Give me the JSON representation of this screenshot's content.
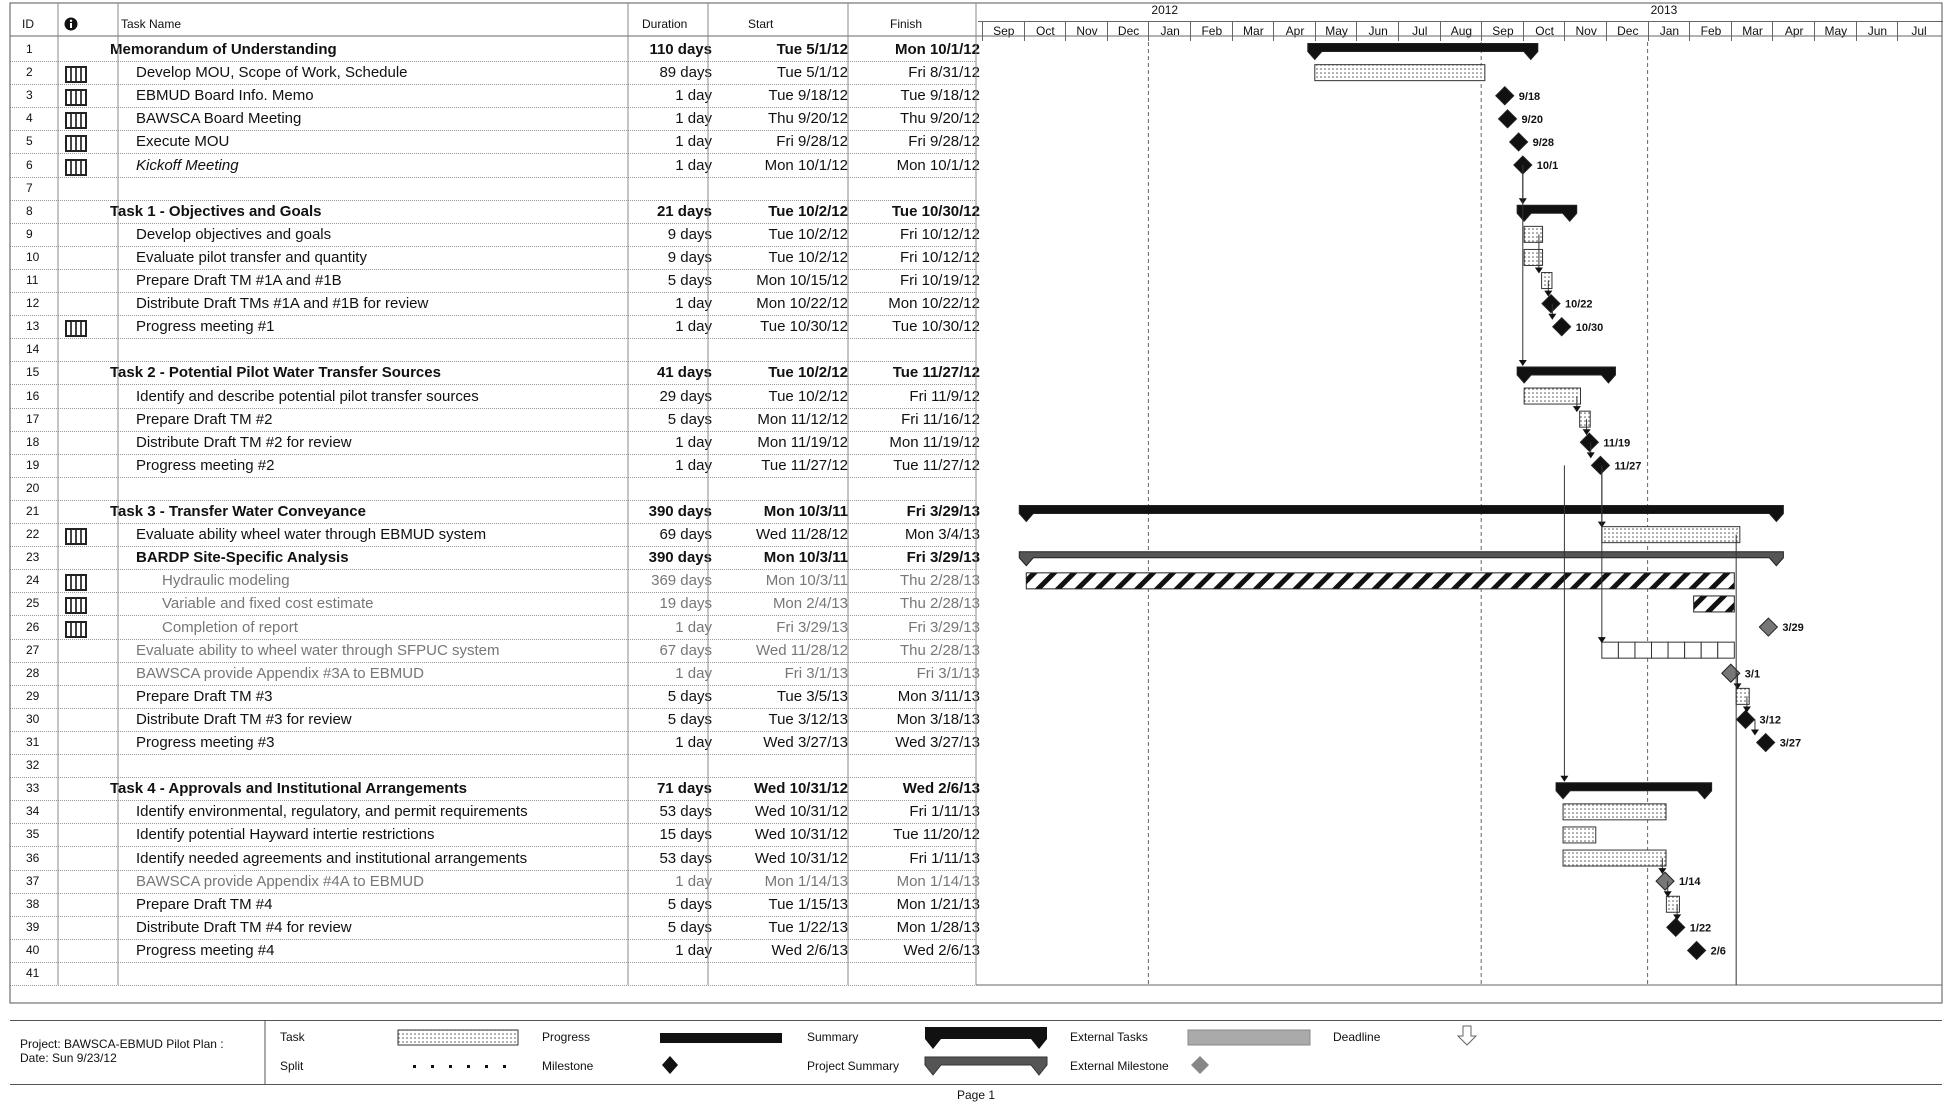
{
  "columns": {
    "id": "ID",
    "info": "info-icon",
    "name": "Task Name",
    "duration": "Duration",
    "start": "Start",
    "finish": "Finish"
  },
  "timeline": {
    "years": [
      {
        "label": "2012",
        "month_index": 4
      },
      {
        "label": "2013",
        "month_index": 16
      }
    ],
    "months": [
      "Sep",
      "Oct",
      "Nov",
      "Dec",
      "Jan",
      "Feb",
      "Mar",
      "Apr",
      "May",
      "Jun",
      "Jul",
      "Aug",
      "Sep",
      "Oct",
      "Nov",
      "Dec",
      "Jan",
      "Feb",
      "Mar",
      "Apr",
      "May",
      "Jun",
      "Jul"
    ]
  },
  "tasks": [
    {
      "id": "1",
      "name": "Memorandum of Understanding",
      "dur": "110 days",
      "start": "Tue 5/1/12",
      "finish": "Mon 10/1/12",
      "style": "sum",
      "indent": 0,
      "bar": {
        "kind": "summary",
        "from": "2012-05-01",
        "to": "2012-10-01"
      }
    },
    {
      "id": "2",
      "note": true,
      "name": "Develop MOU, Scope of Work, Schedule",
      "dur": "89 days",
      "start": "Tue 5/1/12",
      "finish": "Fri 8/31/12",
      "indent": 1,
      "bar": {
        "kind": "task",
        "from": "2012-05-01",
        "to": "2012-08-31"
      }
    },
    {
      "id": "3",
      "note": true,
      "name": "EBMUD Board Info. Memo",
      "dur": "1 day",
      "start": "Tue 9/18/12",
      "finish": "Tue 9/18/12",
      "indent": 1,
      "bar": {
        "kind": "milestone",
        "at": "2012-09-18",
        "label": "9/18"
      }
    },
    {
      "id": "4",
      "note": true,
      "name": "BAWSCA Board Meeting",
      "dur": "1 day",
      "start": "Thu 9/20/12",
      "finish": "Thu 9/20/12",
      "indent": 1,
      "bar": {
        "kind": "milestone",
        "at": "2012-09-20",
        "label": "9/20"
      }
    },
    {
      "id": "5",
      "note": true,
      "name": "Execute MOU",
      "dur": "1 day",
      "start": "Fri 9/28/12",
      "finish": "Fri 9/28/12",
      "indent": 1,
      "bar": {
        "kind": "milestone",
        "at": "2012-09-28",
        "label": "9/28"
      }
    },
    {
      "id": "6",
      "note": true,
      "name": "Kickoff Meeting",
      "dur": "1 day",
      "start": "Mon 10/1/12",
      "finish": "Mon 10/1/12",
      "style": "ital",
      "indent": 1,
      "bar": {
        "kind": "milestone",
        "at": "2012-10-01",
        "label": "10/1"
      }
    },
    {
      "id": "7",
      "name": "",
      "dur": "",
      "start": "",
      "finish": "",
      "indent": 0
    },
    {
      "id": "8",
      "name": "Task 1 - Objectives and Goals",
      "dur": "21 days",
      "start": "Tue 10/2/12",
      "finish": "Tue 10/30/12",
      "style": "sum",
      "indent": 0,
      "bar": {
        "kind": "summary",
        "from": "2012-10-02",
        "to": "2012-10-30"
      }
    },
    {
      "id": "9",
      "name": "Develop objectives and goals",
      "dur": "9 days",
      "start": "Tue 10/2/12",
      "finish": "Fri 10/12/12",
      "indent": 1,
      "bar": {
        "kind": "task",
        "from": "2012-10-02",
        "to": "2012-10-12"
      }
    },
    {
      "id": "10",
      "name": "Evaluate pilot transfer and quantity",
      "dur": "9 days",
      "start": "Tue 10/2/12",
      "finish": "Fri 10/12/12",
      "indent": 1,
      "bar": {
        "kind": "task",
        "from": "2012-10-02",
        "to": "2012-10-12"
      }
    },
    {
      "id": "11",
      "name": "Prepare Draft TM #1A and #1B",
      "dur": "5 days",
      "start": "Mon 10/15/12",
      "finish": "Fri 10/19/12",
      "indent": 1,
      "bar": {
        "kind": "task",
        "from": "2012-10-15",
        "to": "2012-10-19"
      }
    },
    {
      "id": "12",
      "name": "Distribute Draft TMs #1A and #1B for review",
      "dur": "1 day",
      "start": "Mon 10/22/12",
      "finish": "Mon 10/22/12",
      "indent": 1,
      "bar": {
        "kind": "milestone",
        "at": "2012-10-22",
        "label": "10/22"
      }
    },
    {
      "id": "13",
      "note": true,
      "name": "Progress meeting #1",
      "dur": "1 day",
      "start": "Tue 10/30/12",
      "finish": "Tue 10/30/12",
      "indent": 1,
      "bar": {
        "kind": "milestone",
        "at": "2012-10-30",
        "label": "10/30"
      }
    },
    {
      "id": "14",
      "name": "",
      "dur": "",
      "start": "",
      "finish": "",
      "indent": 0
    },
    {
      "id": "15",
      "name": "Task 2 - Potential Pilot Water Transfer Sources",
      "dur": "41 days",
      "start": "Tue 10/2/12",
      "finish": "Tue 11/27/12",
      "style": "sum",
      "indent": 0,
      "bar": {
        "kind": "summary",
        "from": "2012-10-02",
        "to": "2012-11-27"
      }
    },
    {
      "id": "16",
      "name": "Identify and describe potential pilot transfer sources",
      "dur": "29 days",
      "start": "Tue 10/2/12",
      "finish": "Fri 11/9/12",
      "indent": 1,
      "bar": {
        "kind": "task",
        "from": "2012-10-02",
        "to": "2012-11-09"
      }
    },
    {
      "id": "17",
      "name": "Prepare Draft TM #2",
      "dur": "5 days",
      "start": "Mon 11/12/12",
      "finish": "Fri 11/16/12",
      "indent": 1,
      "bar": {
        "kind": "task",
        "from": "2012-11-12",
        "to": "2012-11-16"
      }
    },
    {
      "id": "18",
      "name": "Distribute Draft TM #2 for review",
      "dur": "1 day",
      "start": "Mon 11/19/12",
      "finish": "Mon 11/19/12",
      "indent": 1,
      "bar": {
        "kind": "milestone",
        "at": "2012-11-19",
        "label": "11/19"
      }
    },
    {
      "id": "19",
      "name": "Progress meeting #2",
      "dur": "1 day",
      "start": "Tue 11/27/12",
      "finish": "Tue 11/27/12",
      "indent": 1,
      "bar": {
        "kind": "milestone",
        "at": "2012-11-27",
        "label": "11/27"
      }
    },
    {
      "id": "20",
      "name": "",
      "dur": "",
      "start": "",
      "finish": "",
      "indent": 0
    },
    {
      "id": "21",
      "name": "Task 3 - Transfer Water Conveyance",
      "dur": "390 days",
      "start": "Mon 10/3/11",
      "finish": "Fri 3/29/13",
      "style": "sum",
      "indent": 0,
      "bar": {
        "kind": "summary",
        "from": "2011-10-03",
        "to": "2013-03-29"
      }
    },
    {
      "id": "22",
      "note": true,
      "name": "Evaluate ability wheel water through EBMUD system",
      "dur": "69 days",
      "start": "Wed 11/28/12",
      "finish": "Mon 3/4/13",
      "indent": 1,
      "bar": {
        "kind": "task",
        "from": "2012-11-28",
        "to": "2013-03-04"
      }
    },
    {
      "id": "23",
      "name": "BARDP Site-Specific Analysis",
      "dur": "390 days",
      "start": "Mon 10/3/11",
      "finish": "Fri 3/29/13",
      "style": "sum",
      "indent": 1,
      "bar": {
        "kind": "extsummary",
        "from": "2011-10-03",
        "to": "2013-03-29"
      }
    },
    {
      "id": "24",
      "note": true,
      "name": "Hydraulic modeling",
      "dur": "369 days",
      "start": "Mon 10/3/11",
      "finish": "Thu 2/28/13",
      "style": "grey",
      "indent": 2,
      "bar": {
        "kind": "ext",
        "from": "2011-10-03",
        "to": "2013-02-28"
      }
    },
    {
      "id": "25",
      "note": true,
      "name": "Variable and fixed cost estimate",
      "dur": "19 days",
      "start": "Mon 2/4/13",
      "finish": "Thu 2/28/13",
      "style": "grey",
      "indent": 2,
      "bar": {
        "kind": "ext",
        "from": "2013-02-04",
        "to": "2013-02-28"
      }
    },
    {
      "id": "26",
      "note": true,
      "name": "Completion of report",
      "dur": "1 day",
      "start": "Fri 3/29/13",
      "finish": "Fri 3/29/13",
      "style": "grey",
      "indent": 2,
      "bar": {
        "kind": "extmilestone",
        "at": "2013-03-29",
        "label": "3/29"
      }
    },
    {
      "id": "27",
      "name": "Evaluate ability to wheel water through SFPUC system",
      "dur": "67 days",
      "start": "Wed 11/28/12",
      "finish": "Thu 2/28/13",
      "style": "grey",
      "indent": 1,
      "bar": {
        "kind": "boxes",
        "from": "2012-11-28",
        "to": "2013-02-28"
      }
    },
    {
      "id": "28",
      "name": "BAWSCA provide Appendix #3A to EBMUD",
      "dur": "1 day",
      "start": "Fri 3/1/13",
      "finish": "Fri 3/1/13",
      "style": "grey",
      "indent": 1,
      "bar": {
        "kind": "extmilestone",
        "at": "2013-03-01",
        "label": "3/1"
      }
    },
    {
      "id": "29",
      "name": "Prepare Draft TM #3",
      "dur": "5 days",
      "start": "Tue 3/5/13",
      "finish": "Mon 3/11/13",
      "indent": 1,
      "bar": {
        "kind": "task",
        "from": "2013-03-05",
        "to": "2013-03-11"
      }
    },
    {
      "id": "30",
      "name": "Distribute Draft TM #3 for review",
      "dur": "5 days",
      "start": "Tue 3/12/13",
      "finish": "Mon 3/18/13",
      "indent": 1,
      "bar": {
        "kind": "milestone",
        "at": "2013-03-12",
        "label": "3/12"
      }
    },
    {
      "id": "31",
      "name": "Progress meeting #3",
      "dur": "1 day",
      "start": "Wed 3/27/13",
      "finish": "Wed 3/27/13",
      "indent": 1,
      "bar": {
        "kind": "milestone",
        "at": "2013-03-27",
        "label": "3/27"
      }
    },
    {
      "id": "32",
      "name": "",
      "dur": "",
      "start": "",
      "finish": "",
      "indent": 0
    },
    {
      "id": "33",
      "name": "Task 4 - Approvals and Institutional Arrangements",
      "dur": "71 days",
      "start": "Wed 10/31/12",
      "finish": "Wed 2/6/13",
      "style": "sum",
      "indent": 0,
      "bar": {
        "kind": "summary",
        "from": "2012-10-31",
        "to": "2013-02-06"
      }
    },
    {
      "id": "34",
      "name": "Identify environmental, regulatory, and permit requirements",
      "dur": "53 days",
      "start": "Wed 10/31/12",
      "finish": "Fri 1/11/13",
      "indent": 1,
      "bar": {
        "kind": "task",
        "from": "2012-10-31",
        "to": "2013-01-11"
      }
    },
    {
      "id": "35",
      "name": "Identify potential Hayward intertie restrictions",
      "dur": "15 days",
      "start": "Wed 10/31/12",
      "finish": "Tue 11/20/12",
      "indent": 1,
      "bar": {
        "kind": "task",
        "from": "2012-10-31",
        "to": "2012-11-20"
      }
    },
    {
      "id": "36",
      "name": "Identify needed agreements and institutional arrangements",
      "dur": "53 days",
      "start": "Wed 10/31/12",
      "finish": "Fri 1/11/13",
      "indent": 1,
      "bar": {
        "kind": "task",
        "from": "2012-10-31",
        "to": "2013-01-11"
      }
    },
    {
      "id": "37",
      "name": "BAWSCA provide Appendix #4A to EBMUD",
      "dur": "1 day",
      "start": "Mon 1/14/13",
      "finish": "Mon 1/14/13",
      "style": "grey",
      "indent": 1,
      "bar": {
        "kind": "extmilestone",
        "at": "2013-01-14",
        "label": "1/14"
      }
    },
    {
      "id": "38",
      "name": "Prepare Draft TM #4",
      "dur": "5 days",
      "start": "Tue 1/15/13",
      "finish": "Mon 1/21/13",
      "indent": 1,
      "bar": {
        "kind": "task",
        "from": "2013-01-15",
        "to": "2013-01-21"
      }
    },
    {
      "id": "39",
      "name": "Distribute Draft TM #4 for review",
      "dur": "5 days",
      "start": "Tue 1/22/13",
      "finish": "Mon 1/28/13",
      "indent": 1,
      "bar": {
        "kind": "milestone",
        "at": "2013-01-22",
        "label": "1/22"
      }
    },
    {
      "id": "40",
      "name": "Progress meeting #4",
      "dur": "1 day",
      "start": "Wed 2/6/13",
      "finish": "Wed 2/6/13",
      "indent": 1,
      "bar": {
        "kind": "milestone",
        "at": "2013-02-06",
        "label": "2/6"
      }
    },
    {
      "id": "41",
      "name": "",
      "dur": "",
      "start": "",
      "finish": "",
      "indent": 0
    }
  ],
  "legend": {
    "project_line1": "Project: BAWSCA-EBMUD Pilot Plan :",
    "project_line2": "Date: Sun 9/23/12",
    "task": "Task",
    "split": "Split",
    "progress": "Progress",
    "milestone": "Milestone",
    "summary": "Summary",
    "project_summary": "Project Summary",
    "external_tasks": "External Tasks",
    "external_milestone": "External Milestone",
    "deadline": "Deadline"
  },
  "page": "Page 1"
}
